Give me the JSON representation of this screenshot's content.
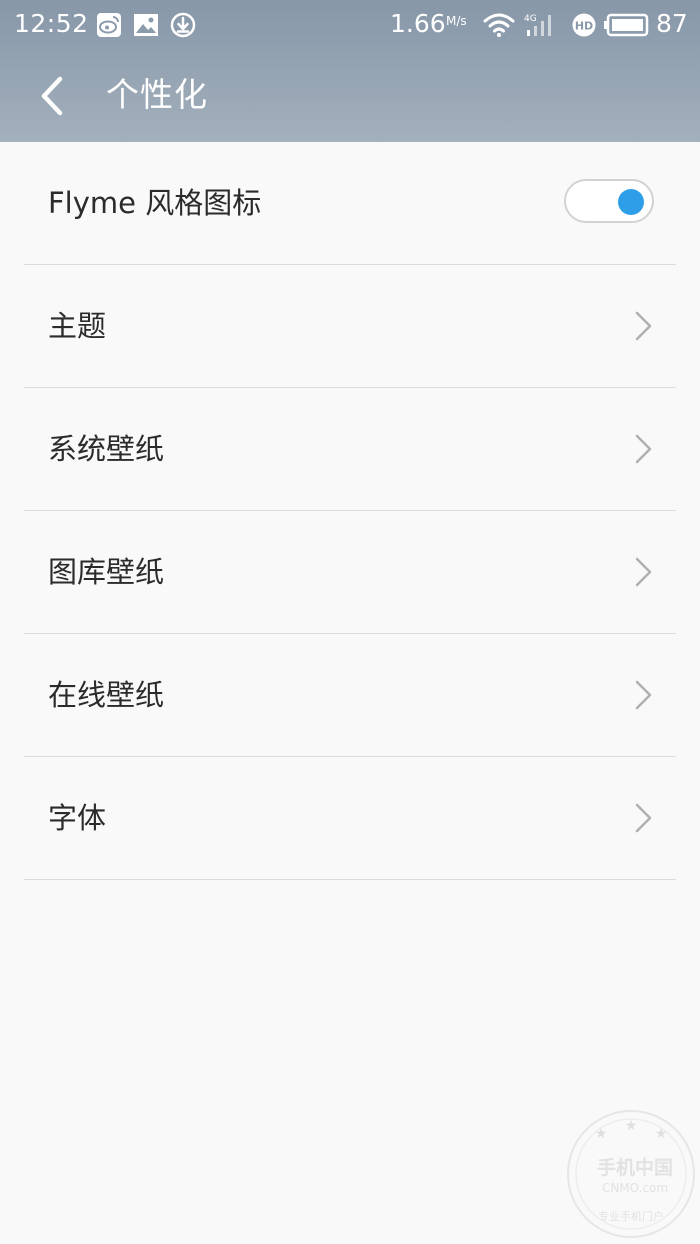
{
  "status_bar": {
    "time": "12:52",
    "net_speed": "1.66",
    "net_speed_unit": "M/s",
    "battery": "87",
    "icons": [
      "weibo-icon",
      "image-icon",
      "download-icon",
      "wifi-icon",
      "signal-4g-icon",
      "hd-icon",
      "battery-icon"
    ]
  },
  "header": {
    "title": "个性化",
    "back_icon": "back-arrow-icon"
  },
  "settings": {
    "flyme_icon_label": "Flyme 风格图标",
    "flyme_icon_enabled": true,
    "items": [
      {
        "label": "主题"
      },
      {
        "label": "系统壁纸"
      },
      {
        "label": "图库壁纸"
      },
      {
        "label": "在线壁纸"
      },
      {
        "label": "字体"
      }
    ]
  },
  "watermark": {
    "brand": "手机中国",
    "site": "CNMO.com",
    "slogan": "专业手机门户"
  },
  "colors": {
    "header_gradient_top": "#8797a8",
    "header_gradient_bottom": "#a3b0bd",
    "background": "#f9f9f9",
    "accent": "#2e9ee8",
    "text": "#2b2b2b",
    "divider": "#dcdcdc",
    "chevron": "#b0b0b0"
  }
}
